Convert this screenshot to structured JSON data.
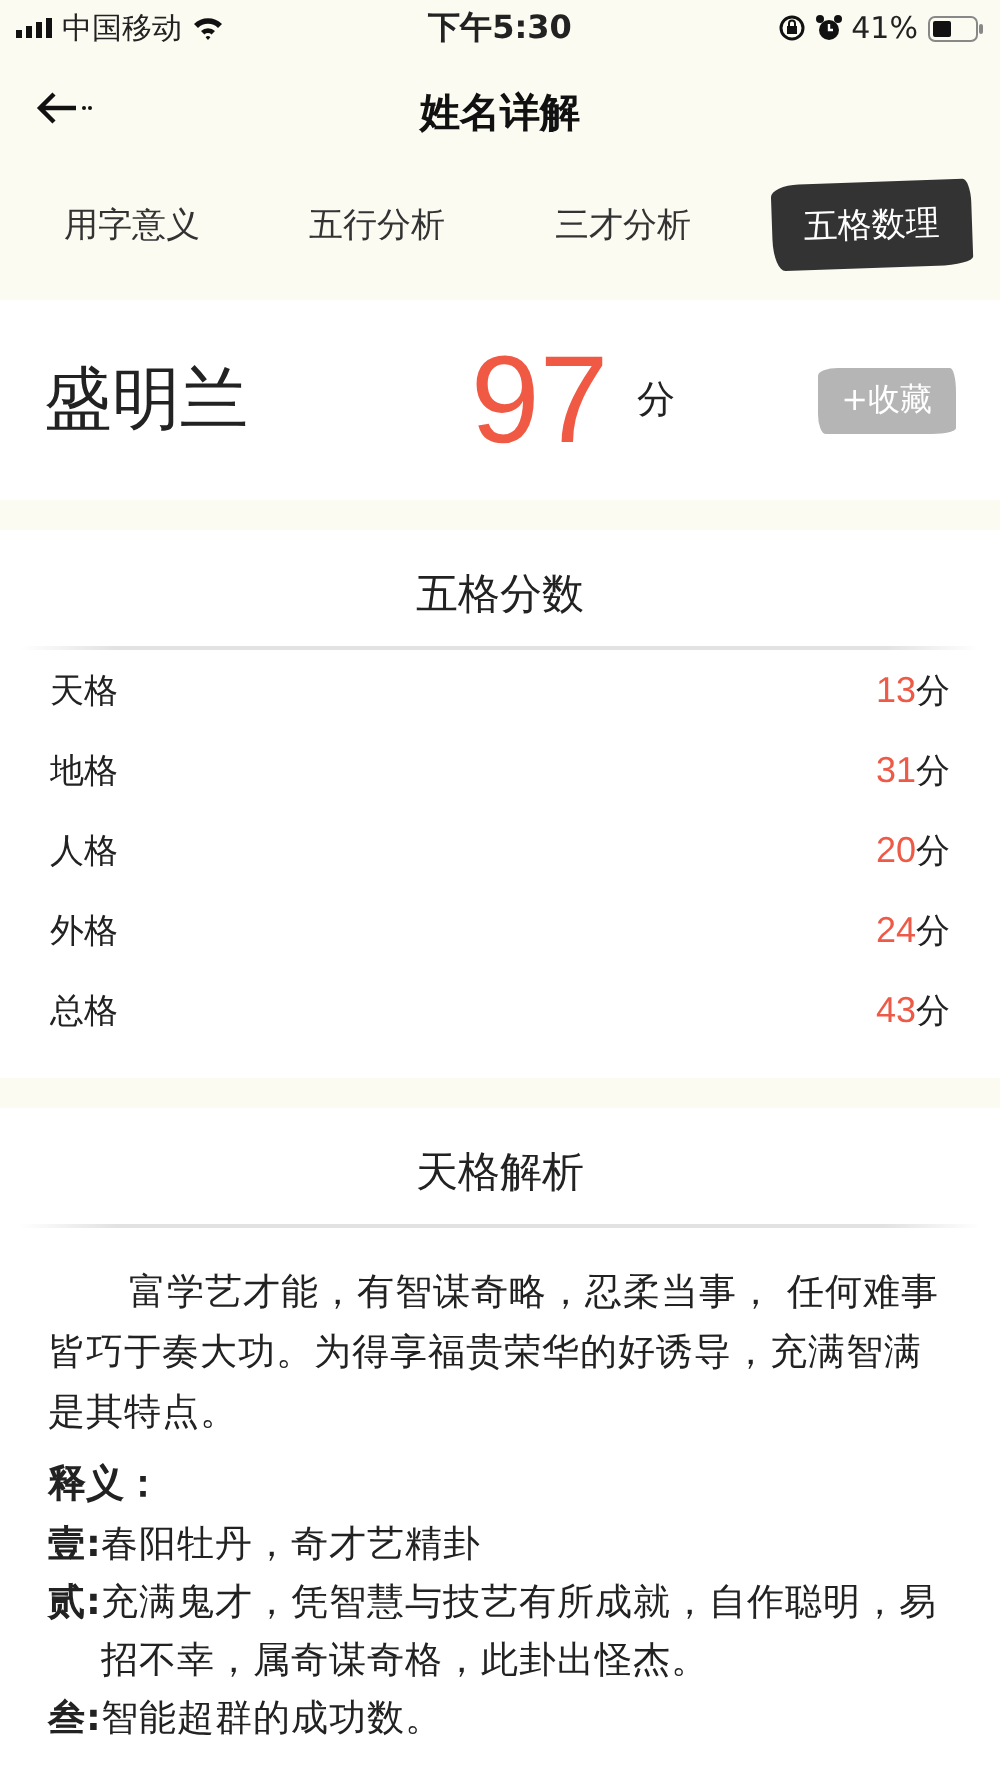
{
  "status_bar": {
    "carrier": "中国移动",
    "time": "下午5:30",
    "battery": "41%"
  },
  "header": {
    "title": "姓名详解"
  },
  "tabs": [
    {
      "label": "用字意义",
      "selected": false
    },
    {
      "label": "五行分析",
      "selected": false
    },
    {
      "label": "三才分析",
      "selected": false
    },
    {
      "label": "五格数理",
      "selected": true
    }
  ],
  "score_card": {
    "name": "盛明兰",
    "score": "97",
    "unit": "分",
    "collect_button": "+收藏"
  },
  "five_grid": {
    "title": "五格分数",
    "rows": [
      {
        "label": "天格",
        "value": "13",
        "unit": "分"
      },
      {
        "label": "地格",
        "value": "31",
        "unit": "分"
      },
      {
        "label": "人格",
        "value": "20",
        "unit": "分"
      },
      {
        "label": "外格",
        "value": "24",
        "unit": "分"
      },
      {
        "label": "总格",
        "value": "43",
        "unit": "分"
      }
    ]
  },
  "analysis": {
    "title": "天格解析",
    "paragraph": "富学艺才能，有智谋奇略，忍柔当事， 任何难事皆巧于奏大功。为得享福贵荣华的好诱导，充满智满是其特点。",
    "definition_heading": "释义：",
    "items": [
      {
        "label": "壹:",
        "text": "春阳牡丹，奇才艺精卦"
      },
      {
        "label": "贰:",
        "text": "充满鬼才，凭智慧与技艺有所成就，自作聪明，易招不幸，属奇谋奇格，此卦出怪杰。"
      },
      {
        "label": "叁:",
        "text": "智能超群的成功数。"
      }
    ]
  }
}
